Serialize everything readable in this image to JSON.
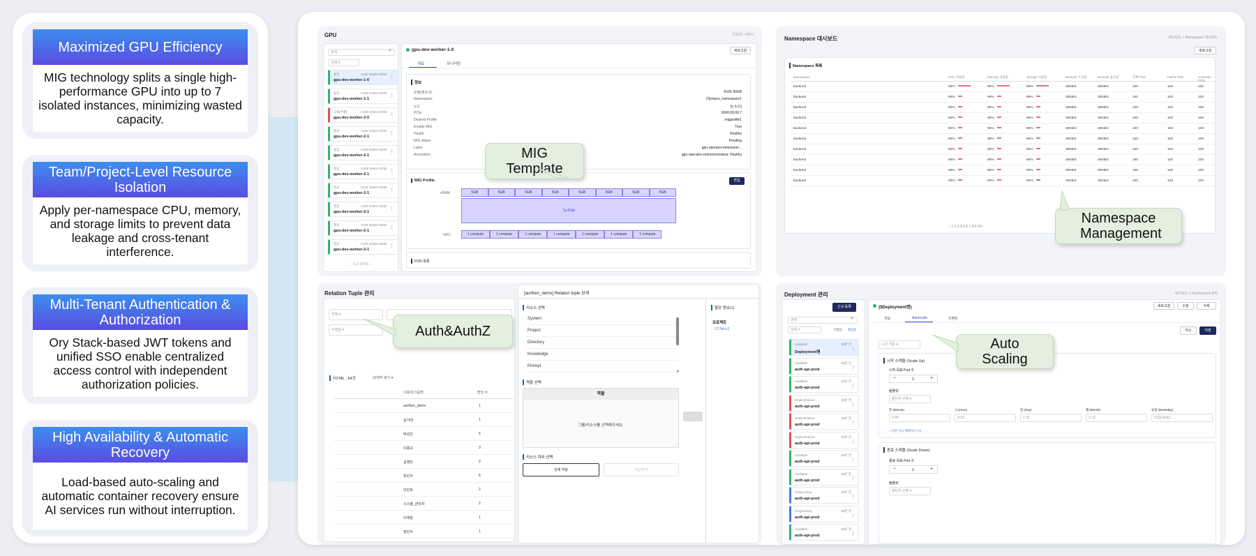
{
  "features": [
    {
      "title": "Maximized GPU Efficiency",
      "body": "MIG technology splits a single high-performance GPU into up to 7 isolated instances, minimizing wasted capacity."
    },
    {
      "title": "Team/Project-Level Resource Isolation",
      "body": "Apply per-namespace CPU, memory, and storage limits to prevent data leakage and cross-tenant interference."
    },
    {
      "title": "Multi-Tenant Authentication & Authorization",
      "body": "Ory Stack-based JWT tokens and unified SSO enable centralized access control with independent authorization policies."
    },
    {
      "title": "High Availability & Automatic Recovery",
      "body": "Load-based auto-scaling and automatic container recovery ensure AI services run without interruption."
    }
  ],
  "callouts": {
    "mig": "MIG Template",
    "namespace": "Namespace Management",
    "auth": "Auth&AuthZ",
    "scaling": "Auto Scaling"
  },
  "gpu_panel": {
    "title": "GPU",
    "crumb": "인프라 > GPU",
    "search_placeholder": "검색",
    "select_label": "선택",
    "items": [
      {
        "status": "정상",
        "model": "A100-SXM4-40GB",
        "name": "gpu-dev-worker-1-0",
        "color": "green",
        "selected": true
      },
      {
        "status": "정상",
        "model": "A100-SXM4-40GB",
        "name": "gpu-dev-worker-1-1",
        "color": "green"
      },
      {
        "status": "오류(주황)",
        "model": "A100-SXM4-40GB",
        "name": "gpu-dev-worker-2-0",
        "color": "red"
      },
      {
        "status": "정상",
        "model": "A100-SXM4-40GB",
        "name": "gpu-dev-worker-2-1",
        "color": "green"
      },
      {
        "status": "정상",
        "model": "A100-SXM4-40GB",
        "name": "gpu-dev-worker-2-1",
        "color": "green"
      },
      {
        "status": "정상",
        "model": "A100-SXM4-40GB",
        "name": "gpu-dev-worker-2-1",
        "color": "green"
      },
      {
        "status": "정상",
        "model": "A100-SXM4-40GB",
        "name": "gpu-dev-worker-2-1",
        "color": "green"
      },
      {
        "status": "정상",
        "model": "A100-SXM4-40GB",
        "name": "gpu-dev-worker-2-1",
        "color": "green"
      },
      {
        "status": "정상",
        "model": "A100-SXM4-40GB",
        "name": "gpu-dev-worker-2-1",
        "color": "green"
      },
      {
        "status": "정상",
        "model": "A100-SXM4-40GB",
        "name": "gpu-dev-worker-2-1",
        "color": "green"
      }
    ],
    "pagination": "‹ 1 2 3 4 5 ›",
    "detail_name": "gpu-dev-worker-1-0",
    "refresh": "새로고침",
    "tabs": [
      "개요",
      "모니터링"
    ],
    "info_title": "정보",
    "info_rows": [
      {
        "k": "모델(제조사)",
        "v": "A100 40GB"
      },
      {
        "k": "Namespace",
        "v": "Olympos_namespace1"
      },
      {
        "k": "노드",
        "v": "[n.노드]"
      },
      {
        "k": "PCIe",
        "v": "0000:00:00.7"
      },
      {
        "k": "Desired Profile",
        "v": "migprofile1"
      },
      {
        "k": "Enable MIG",
        "v": "True"
      },
      {
        "k": "Health",
        "v": "Healthy"
      },
      {
        "k": "MIG phase",
        "v": "Pending"
      },
      {
        "k": "Label",
        "v": "gpu-operator-extension/..."
      },
      {
        "k": "Annotation",
        "v": "gpu-operator-extension/status: Healthy"
      }
    ],
    "mig_title": "MIG Profile",
    "edit": "편집",
    "vram_label": "vRAM",
    "gpc_label": "GPC",
    "vram_cells": [
      "5GB",
      "5GB",
      "5GB",
      "5GB",
      "5GB",
      "5GB",
      "5GB",
      "5GB"
    ],
    "mig_block": "7g.40gb",
    "gpc_cells": [
      "1 compute",
      "1 compute",
      "1 compute",
      "1 compute",
      "1 compute",
      "1 compute",
      "1 compute"
    ],
    "pod_title": "POD 목록"
  },
  "ns_panel": {
    "title": "Namespace 대시보드",
    "crumb": "대시보드 > Namespace 대시보드",
    "refresh": "새로고침",
    "list_title": "Namespace 목록",
    "headers": [
      "Namespace",
      "CPU 사용량",
      "Memory 사용량",
      "Storage 사용량",
      "Network 수신량",
      "Network 송신량",
      "전체 POD",
      "Failed POD",
      "Unknown POD"
    ],
    "rows": [
      [
        "backend",
        "90%",
        "90%",
        "90%",
        "30KB/s",
        "30KB/s",
        "100",
        "100",
        "100"
      ],
      [
        "backend",
        "90%",
        "90%",
        "90%",
        "30KB/s",
        "30KB/s",
        "100",
        "100",
        "100"
      ],
      [
        "backend",
        "90%",
        "90%",
        "90%",
        "30KB/s",
        "30KB/s",
        "100",
        "100",
        "100"
      ],
      [
        "backend",
        "90%",
        "90%",
        "90%",
        "30KB/s",
        "30KB/s",
        "100",
        "100",
        "100"
      ],
      [
        "backend",
        "90%",
        "90%",
        "90%",
        "30KB/s",
        "30KB/s",
        "100",
        "100",
        "100"
      ],
      [
        "backend",
        "90%",
        "90%",
        "90%",
        "30KB/s",
        "30KB/s",
        "100",
        "100",
        "100"
      ],
      [
        "backend",
        "90%",
        "90%",
        "90%",
        "30KB/s",
        "30KB/s",
        "100",
        "100",
        "100"
      ],
      [
        "backend",
        "90%",
        "90%",
        "90%",
        "30KB/s",
        "30KB/s",
        "100",
        "100",
        "100"
      ],
      [
        "backend",
        "90%",
        "90%",
        "90%",
        "30KB/s",
        "30KB/s",
        "100",
        "100",
        "100"
      ],
      [
        "backend",
        "90%",
        "90%",
        "90%",
        "30KB/s",
        "30KB/s",
        "100",
        "100",
        "100"
      ]
    ],
    "pagination": "‹ 1 2 3 4 5 6 7 8 9 10 ›"
  },
  "rt_panel": {
    "title": "Relation Tuple 관리",
    "filter1": "전체",
    "filter2": "수정일",
    "total": "TOTAL : 64건",
    "per_page": "10개씩 보기",
    "headers": [
      "사용자/그룹명",
      "할당 수"
    ],
    "rows": [
      [
        "aurthen_demo",
        "1"
      ],
      [
        "김기태",
        "1"
      ],
      [
        "박성진",
        "6"
      ],
      [
        "이종규",
        "3"
      ],
      [
        "김영민",
        "2"
      ],
      [
        "최민우",
        "5"
      ],
      [
        "이민호",
        "2"
      ],
      [
        "시스템_관리자",
        "2"
      ],
      [
        "이재훈",
        "1"
      ],
      [
        "정민수",
        "1"
      ]
    ],
    "detail_title": "[aurthen_demo] Relation tuple 상세",
    "resource_select": "리소스 선택",
    "resources": [
      "System",
      "Project",
      "Directory",
      "Knowledge",
      "Prompt"
    ],
    "role_select": "역할 선택",
    "role_header": "역할",
    "role_empty": "그룹/리소스를 선택해주세요.",
    "sub_select": "리소스 하위 선택",
    "btn_all": "전체 적용",
    "btn_add": "리턴 추가",
    "assign_title": "할당 정보(1)",
    "project_label": "프로젝트",
    "project_value": "077bfcc2"
  },
  "dep_panel": {
    "title": "Deployment 관리",
    "crumb": "워크로드 > Deployment 관리",
    "new_btn": "신규 등록",
    "search_placeholder": "검색",
    "state_label": "상태",
    "sort_name": "이름순",
    "sort_recent": "최신순",
    "items": [
      {
        "status": "Available",
        "name": "Deployment명",
        "age": "58분 전",
        "color": "green",
        "selected": true
      },
      {
        "status": "Available",
        "name": "auth-api-prod",
        "age": "58분 전",
        "color": "green"
      },
      {
        "status": "Available",
        "name": "auth-api-prod",
        "age": "58분 전",
        "color": "green"
      },
      {
        "status": "ReplicaFailure",
        "name": "auth-api-prod",
        "age": "58분 전",
        "color": "red"
      },
      {
        "status": "ReplicaFailure",
        "name": "auth-api-prod",
        "age": "58분 전",
        "color": "red"
      },
      {
        "status": "ReplicaFailure",
        "name": "auth-api-prod",
        "age": "58분 전",
        "color": "red"
      },
      {
        "status": "Available",
        "name": "auth-api-prod",
        "age": "58분 전",
        "color": "green"
      },
      {
        "status": "Available",
        "name": "auth-api-prod",
        "age": "58분 전",
        "color": "green"
      },
      {
        "status": "Progressing",
        "name": "auth-api-prod",
        "age": "58분 전",
        "color": "blue"
      },
      {
        "status": "Progressing",
        "name": "auth-api-prod",
        "age": "58분 전",
        "color": "blue"
      },
      {
        "status": "Available",
        "name": "auth-api-prod",
        "age": "58분 전",
        "color": "green"
      }
    ],
    "detail_name": "{$Deployment명}",
    "btn_refresh": "새로고침",
    "btn_edit": "수정",
    "btn_delete": "삭제",
    "tabs": [
      "개요",
      "Autoscale",
      "이벤트"
    ],
    "btn_cancel": "취소",
    "btn_save": "저장",
    "time_basis": "시간 기준",
    "scale_up_title": "시작 스케줄 (Scale Up)",
    "target_pod_up": "시작 목표 Pod 수",
    "stepper_minus": "−",
    "stepper_value": "1",
    "stepper_plus": "+",
    "cycle_label": "템플릿",
    "cycle_value": "분단위 선택",
    "cron_labels": [
      "분 (Minute)",
      "시 (Hour)",
      "일 (Day)",
      "월 (Month)",
      "요일 (Weekday)"
    ],
    "cron_placeholders": [
      "0-59",
      "0-23",
      "1-31",
      "1-12",
      "0(일)-6(토)"
    ],
    "add_rule": "+ 다른 기능 확대하기 (?)",
    "scale_down_title": "종료 스케줄 (Scale Down)",
    "target_pod_down": "종료 목표 Pod 수",
    "cycle_value_down": "분단위 선택"
  }
}
